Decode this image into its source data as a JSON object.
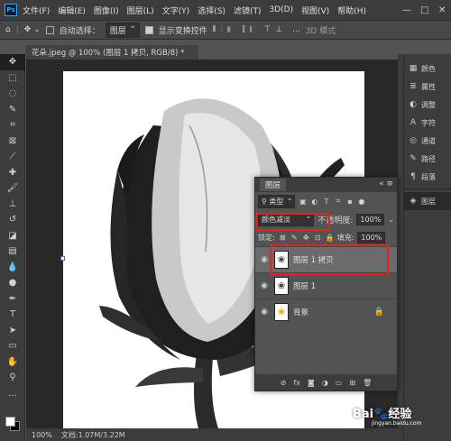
{
  "app": {
    "logo_text": "Ps"
  },
  "menubar": {
    "items": [
      "文件(F)",
      "编辑(E)",
      "图像(I)",
      "图层(L)",
      "文字(Y)",
      "选择(S)",
      "滤镜(T)",
      "3D(D)",
      "视图(V)",
      "帮助(H)"
    ],
    "window_controls": [
      "—",
      "□",
      "✕"
    ]
  },
  "options_bar": {
    "auto_select_label": "自动选择：",
    "auto_select_target": "图层",
    "show_transform_label": "显示变换控件",
    "more": "...",
    "mode_3d": "3D 模式"
  },
  "document": {
    "tab_title": "花朵.jpeg @ 100% (图层 1 拷贝, RGB/8) *",
    "zoom": "100%",
    "doc_info": "文档:1.07M/3.22M"
  },
  "right_panel": {
    "items": [
      {
        "icon": "color-icon",
        "glyph": "▦",
        "label": "颜色"
      },
      {
        "icon": "properties-icon",
        "glyph": "≣",
        "label": "属性"
      },
      {
        "icon": "adjust-icon",
        "glyph": "◐",
        "label": "调整"
      },
      {
        "icon": "character-icon",
        "glyph": "A",
        "label": "字符"
      },
      {
        "icon": "channels-icon",
        "glyph": "◎",
        "label": "通道"
      },
      {
        "icon": "paths-icon",
        "glyph": "✎",
        "label": "路径"
      },
      {
        "icon": "paragraph-icon",
        "glyph": "¶",
        "label": "段落"
      }
    ],
    "layers_item": {
      "icon": "layers-icon",
      "glyph": "◈",
      "label": "图层"
    }
  },
  "layers_panel": {
    "tab": "图层",
    "filter_kind": "类型",
    "blend_mode": "颜色减淡",
    "opacity_label": "不透明度:",
    "opacity": "100%",
    "lock_label": "锁定:",
    "fill_label": "填充:",
    "fill": "100%",
    "layers": [
      {
        "name": "图层 1 拷贝",
        "selected": true,
        "locked": false
      },
      {
        "name": "图层 1",
        "selected": false,
        "locked": false
      },
      {
        "name": "背景",
        "selected": false,
        "locked": true
      }
    ],
    "footer_icons": [
      "⊘",
      "fx",
      "◙",
      "◑",
      "▭",
      "⊞",
      "🗑"
    ]
  },
  "highlight_color": "#e0241f",
  "watermark": {
    "text": "Bai🐾经验",
    "url": "jingyan.baidu.com"
  }
}
